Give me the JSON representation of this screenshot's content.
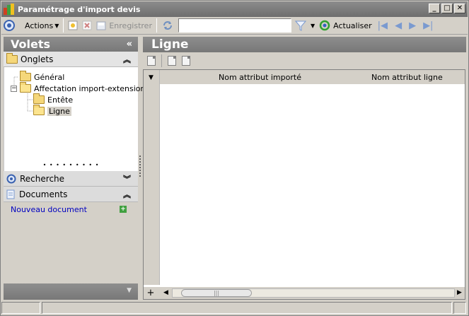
{
  "window": {
    "title": "Paramétrage d'import devis",
    "controls": [
      "_",
      "□",
      "✕"
    ]
  },
  "toolbar": {
    "actions_label": "Actions",
    "save_label": "Enregistrer",
    "search_value": "",
    "refresh_label": "Actualiser"
  },
  "left_panel": {
    "title": "Volets",
    "collapse_glyph": "«",
    "onglets": {
      "label": "Onglets",
      "tree": [
        {
          "label": "Général",
          "level": 1
        },
        {
          "label": "Affectation import-extension",
          "level": 1,
          "expanded": true
        },
        {
          "label": "Entête",
          "level": 2
        },
        {
          "label": "Ligne",
          "level": 2,
          "selected": true
        }
      ]
    },
    "recherche": {
      "label": "Recherche"
    },
    "documents": {
      "label": "Documents",
      "new_doc_label": "Nouveau document"
    }
  },
  "right_panel": {
    "title": "Ligne",
    "columns": [
      "Nom attribut importé",
      "Nom attribut ligne"
    ],
    "rows": []
  },
  "colors": {
    "header_gray": "#808080",
    "link_blue": "#0000c0",
    "folder_yellow": "#f5d77a"
  }
}
